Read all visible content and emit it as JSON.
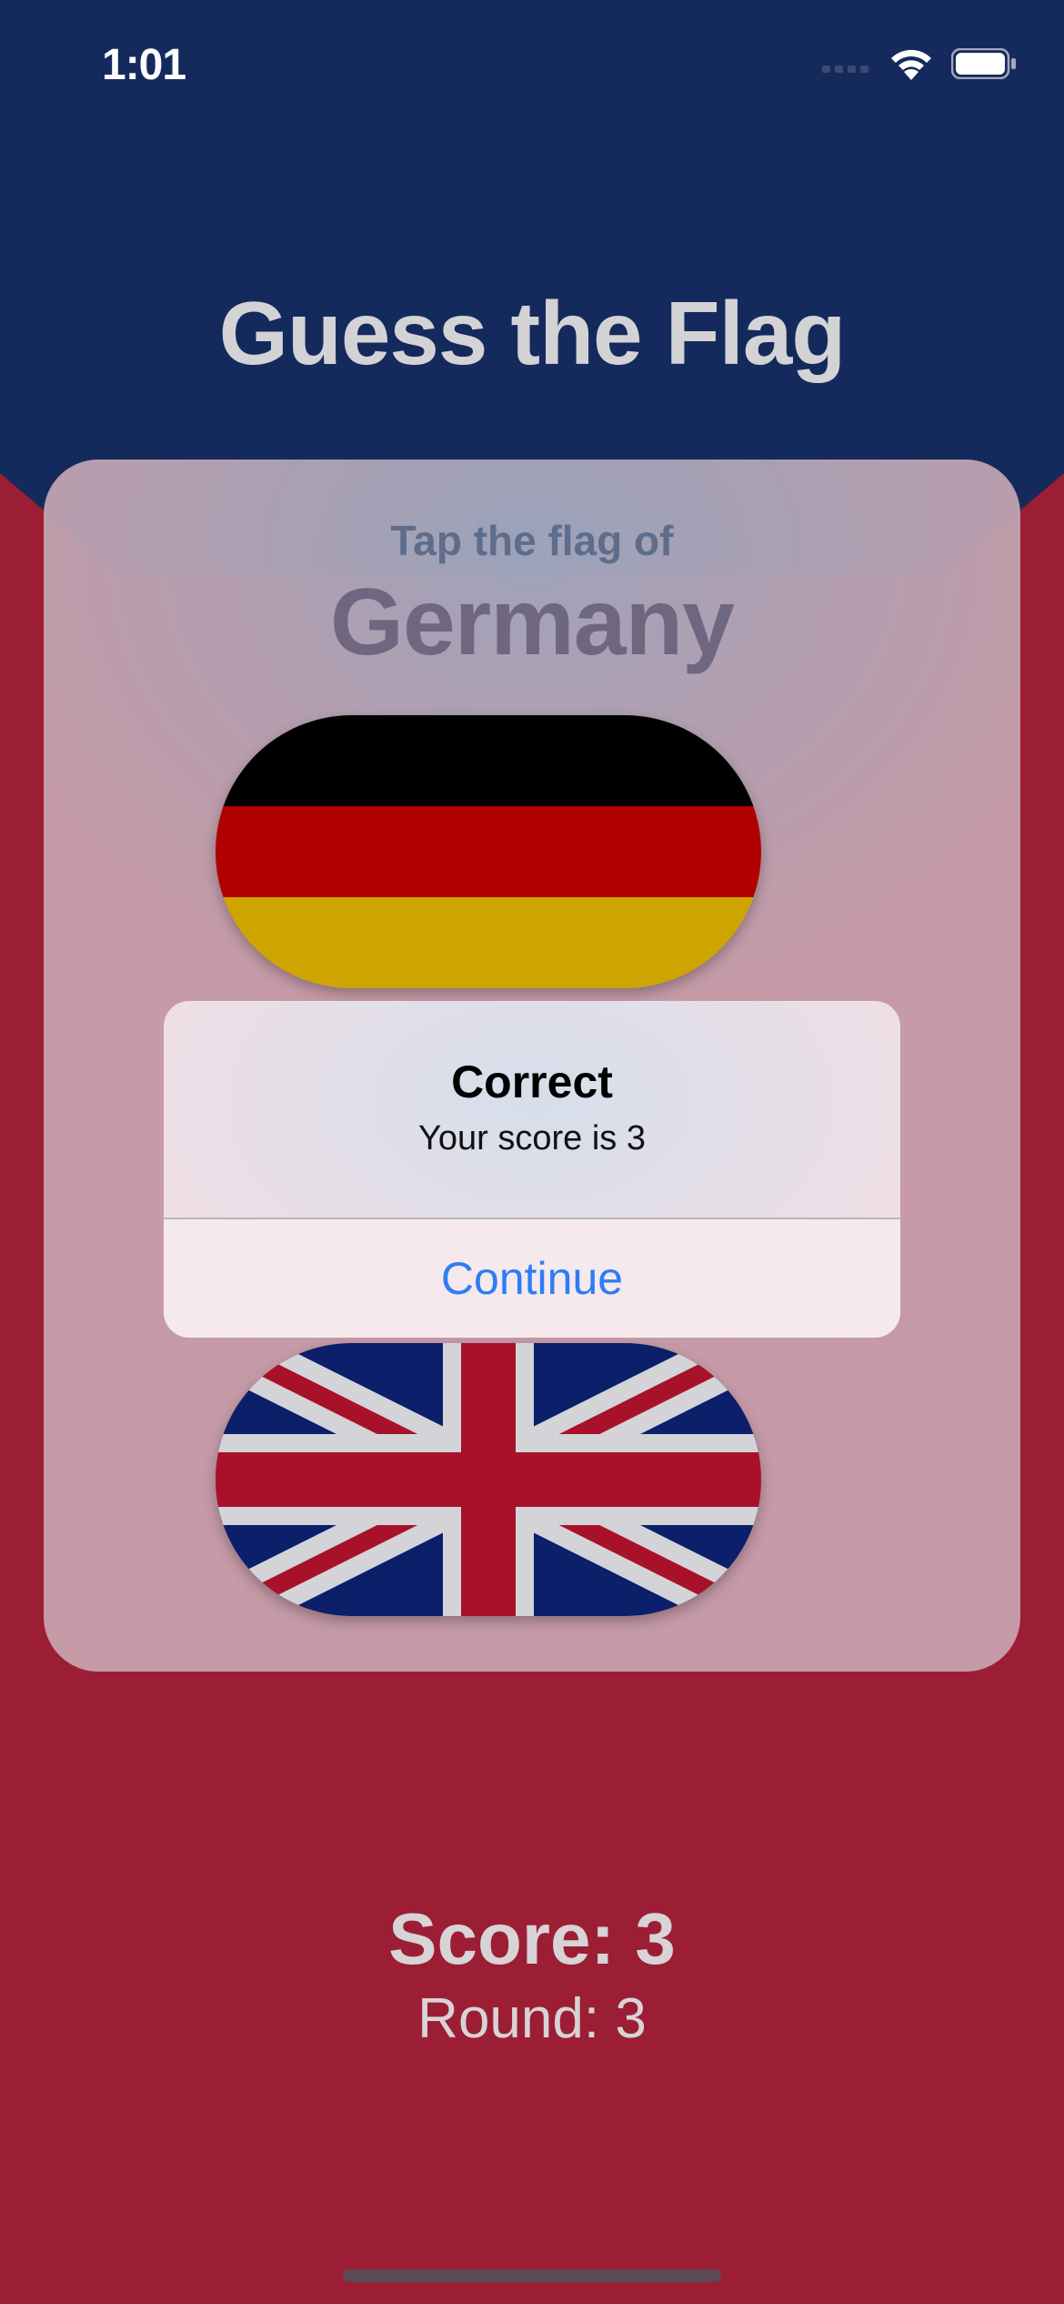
{
  "status_bar": {
    "time": "1:01",
    "icons": [
      "signal-icon",
      "wifi-icon",
      "battery-icon"
    ]
  },
  "app": {
    "title": "Guess the Flag",
    "colors": {
      "top": "#152a5c",
      "bottom": "#9c1e34"
    }
  },
  "question": {
    "prompt": "Tap the flag of",
    "country": "Germany"
  },
  "flags": [
    {
      "name": "Germany",
      "icon": "germany-flag"
    },
    {
      "name": "UK",
      "icon": "uk-flag"
    }
  ],
  "alert": {
    "title": "Correct",
    "message": "Your score is 3",
    "button": "Continue",
    "button_color": "#2f7cf6"
  },
  "footer": {
    "score": "Score: 3",
    "round": "Round: 3"
  }
}
